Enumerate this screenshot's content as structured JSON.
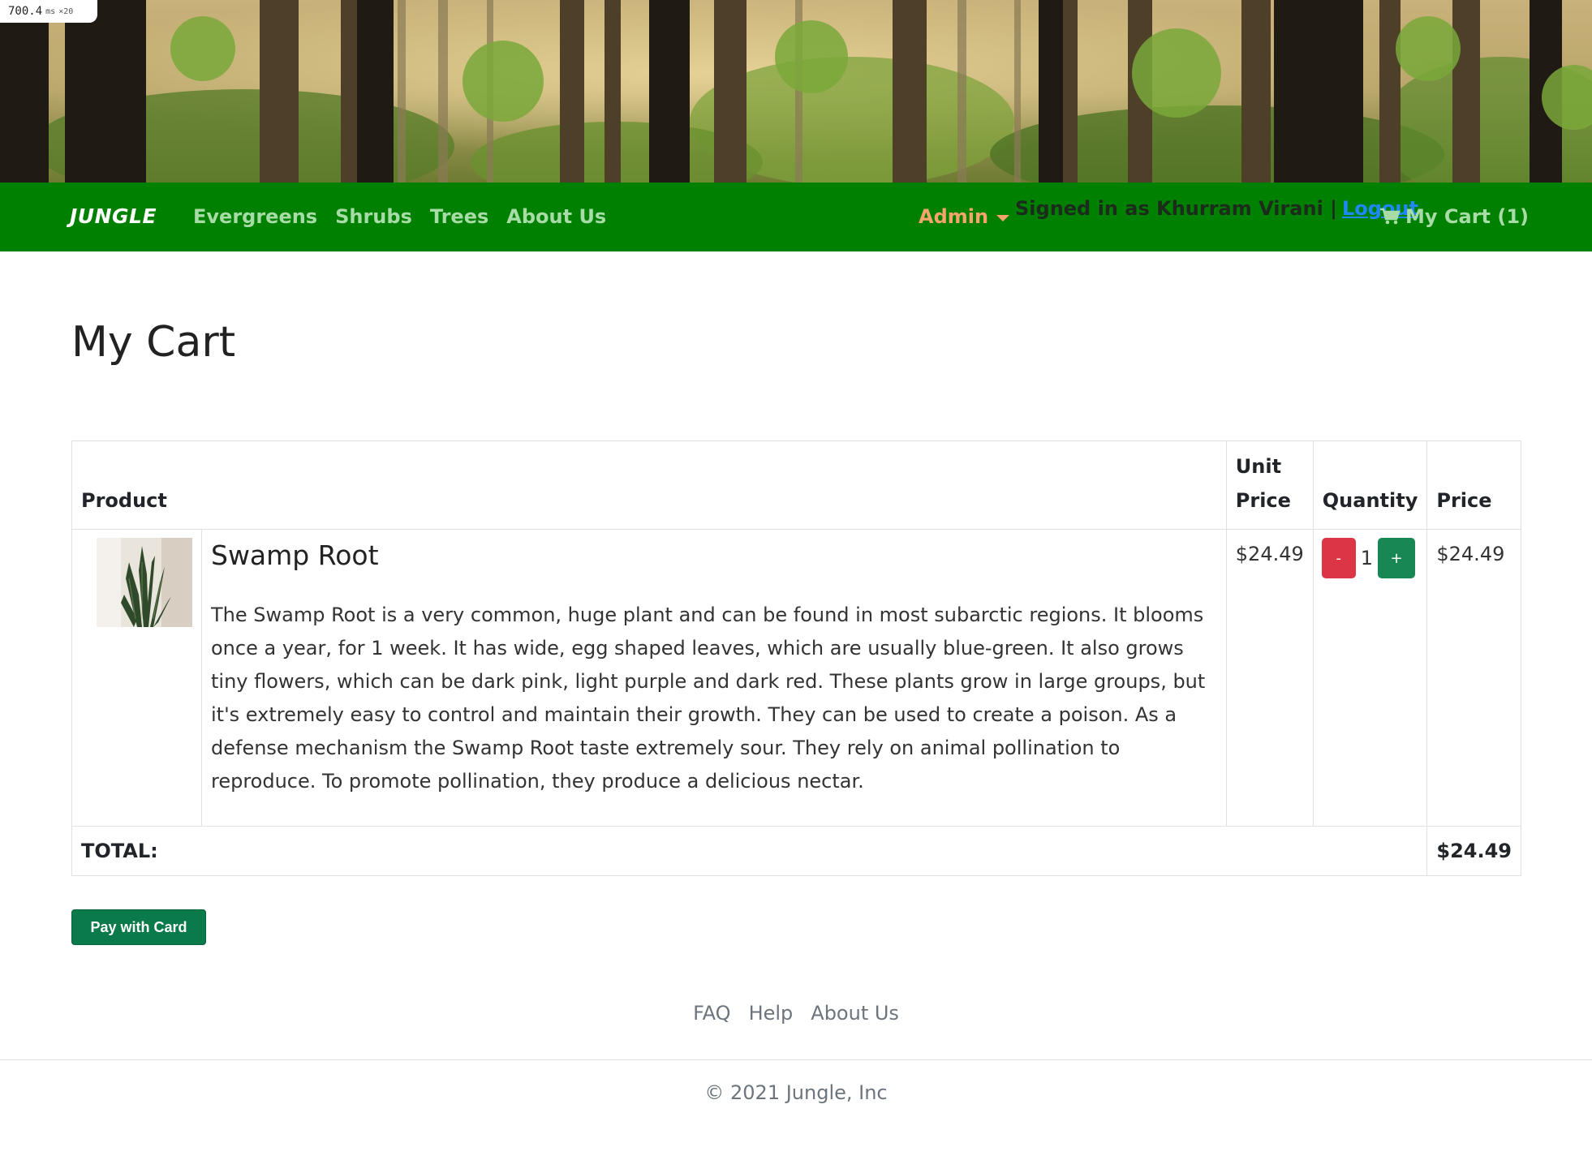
{
  "perf": {
    "time": "700.4",
    "unit": "ms",
    "mult": "×20"
  },
  "colors": {
    "navbar": "#008000",
    "nav_link": "#a7dca7",
    "admin": "#f6a46b",
    "logout": "#1e88ff",
    "minus_btn": "#dc3545",
    "plus_btn": "#198754",
    "pay_btn": "#0b7a4a"
  },
  "nav": {
    "brand": "JUNGLE",
    "links": [
      "Evergreens",
      "Shrubs",
      "Trees",
      "About Us"
    ],
    "admin": "Admin",
    "signed_in": "Signed in as Khurram Virani |",
    "logout": "Logout",
    "cart": "My Cart (1)"
  },
  "page": {
    "title": "My Cart"
  },
  "table": {
    "headers": {
      "product": "Product",
      "unit_price": "Unit Price",
      "quantity": "Quantity",
      "price": "Price"
    },
    "rows": [
      {
        "name": "Swamp Root",
        "description": "The Swamp Root is a very common, huge plant and can be found in most subarctic regions. It blooms once a year, for 1 week. It has wide, egg shaped leaves, which are usually blue-green. It also grows tiny flowers, which can be dark pink, light purple and dark red. These plants grow in large groups, but it's extremely easy to control and maintain their growth. They can be used to create a poison. As a defense mechanism the Swamp Root taste extremely sour. They rely on animal pollination to reproduce. To promote pollination, they produce a delicious nectar.",
        "unit_price": "$24.49",
        "quantity": "1",
        "minus": "-",
        "plus": "+",
        "price": "$24.49"
      }
    ],
    "total_label": "TOTAL:",
    "total_value": "$24.49"
  },
  "pay_button": "Pay with Card",
  "footer": {
    "links": [
      "FAQ",
      "Help",
      "About Us"
    ],
    "copyright": "© 2021 Jungle, Inc"
  }
}
